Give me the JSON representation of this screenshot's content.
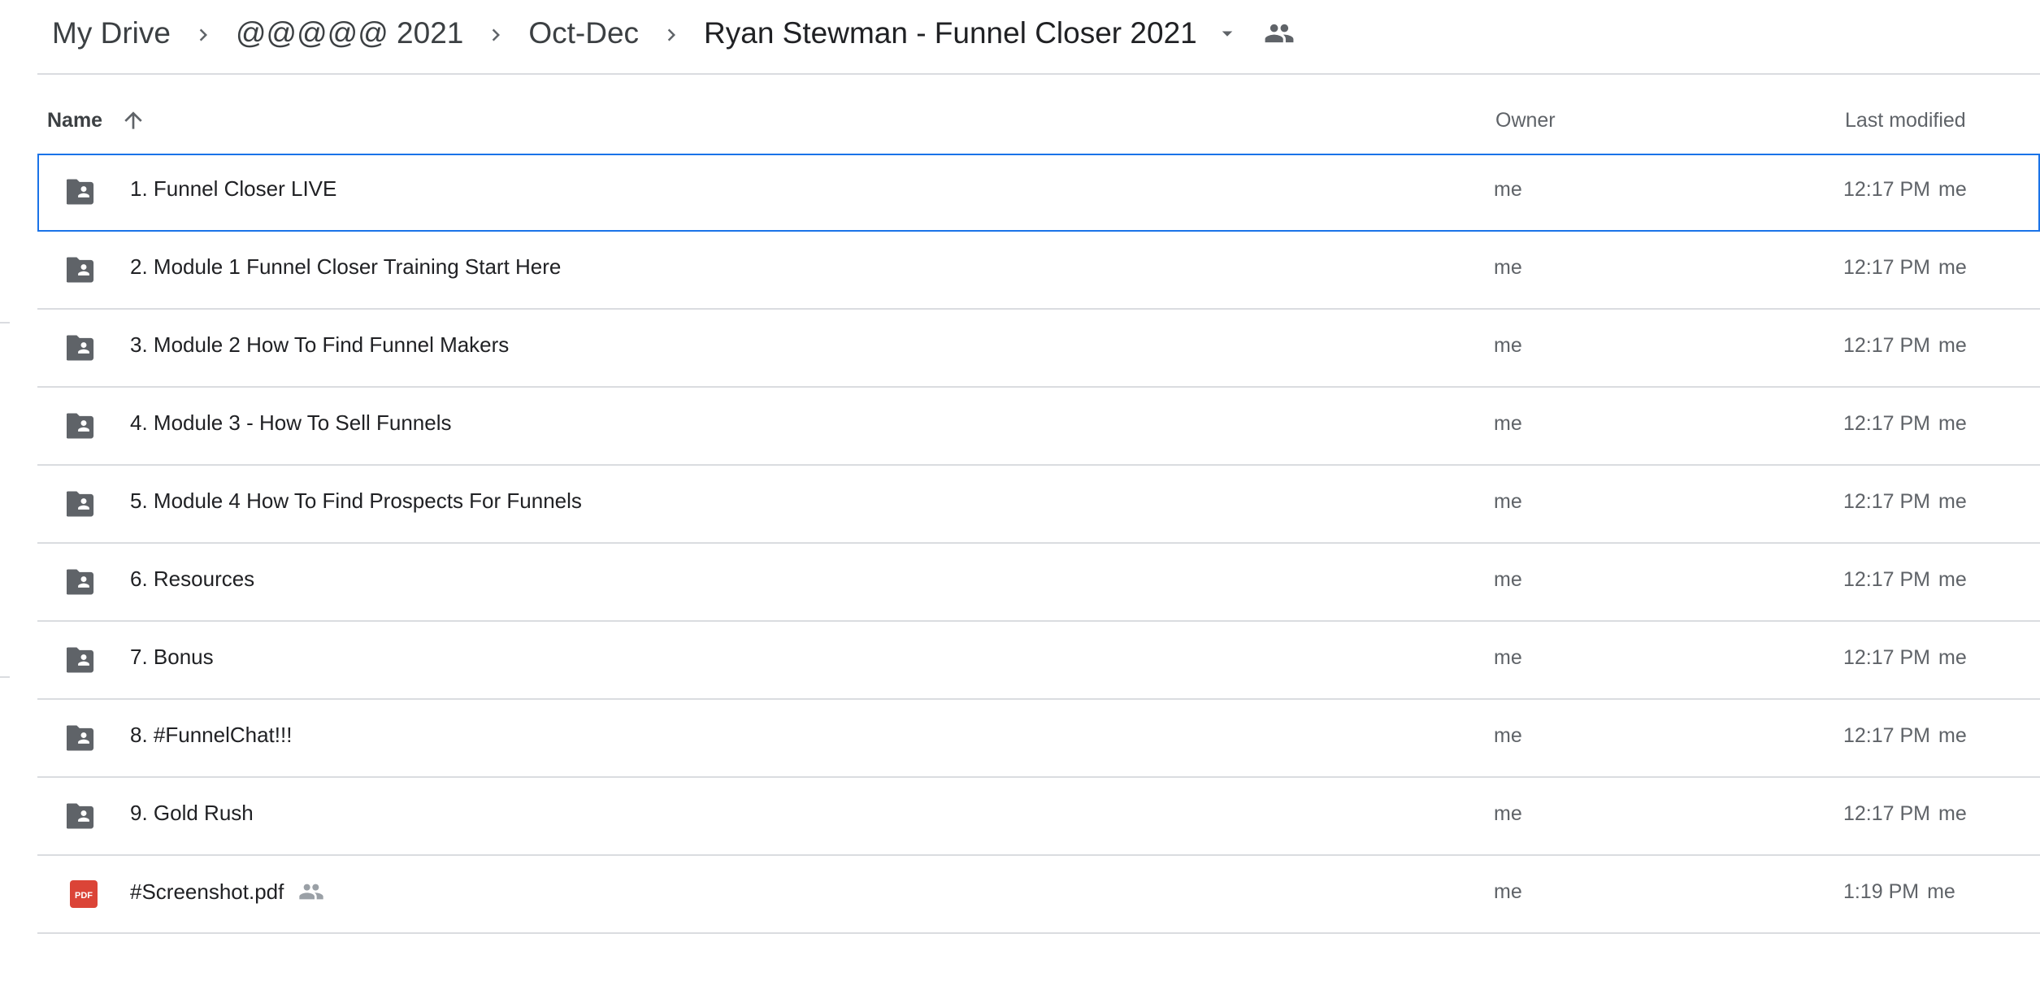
{
  "breadcrumb": {
    "items": [
      "My Drive",
      "@@@@@ 2021",
      "Oct-Dec",
      "Ryan Stewman - Funnel Closer 2021"
    ]
  },
  "columns": {
    "name": "Name",
    "owner": "Owner",
    "last_modified": "Last modified"
  },
  "files": [
    {
      "name": "1. Funnel Closer LIVE",
      "type": "shared-folder",
      "owner": "me",
      "modified": "12:17 PM",
      "modified_by": "me",
      "selected": true
    },
    {
      "name": "2. Module 1 Funnel Closer Training Start Here",
      "type": "shared-folder",
      "owner": "me",
      "modified": "12:17 PM",
      "modified_by": "me"
    },
    {
      "name": "3. Module 2 How To Find Funnel Makers",
      "type": "shared-folder",
      "owner": "me",
      "modified": "12:17 PM",
      "modified_by": "me"
    },
    {
      "name": "4. Module 3 - How To Sell Funnels",
      "type": "shared-folder",
      "owner": "me",
      "modified": "12:17 PM",
      "modified_by": "me"
    },
    {
      "name": "5. Module 4 How To Find Prospects For Funnels",
      "type": "shared-folder",
      "owner": "me",
      "modified": "12:17 PM",
      "modified_by": "me"
    },
    {
      "name": "6. Resources",
      "type": "shared-folder",
      "owner": "me",
      "modified": "12:17 PM",
      "modified_by": "me"
    },
    {
      "name": "7. Bonus",
      "type": "shared-folder",
      "owner": "me",
      "modified": "12:17 PM",
      "modified_by": "me"
    },
    {
      "name": "8. #FunnelChat!!!",
      "type": "shared-folder",
      "owner": "me",
      "modified": "12:17 PM",
      "modified_by": "me"
    },
    {
      "name": "9. Gold Rush",
      "type": "shared-folder",
      "owner": "me",
      "modified": "12:17 PM",
      "modified_by": "me"
    },
    {
      "name": "#Screenshot.pdf",
      "type": "pdf",
      "pdf_badge": "PDF",
      "shared": true,
      "owner": "me",
      "modified": "1:19 PM",
      "modified_by": "me"
    }
  ],
  "icons": {
    "separator": "chevron-right-icon",
    "dropdown": "arrow-drop-down-icon",
    "shared": "people-icon",
    "sort": "arrow-upward-icon",
    "folder": "shared-folder-icon",
    "pdf": "pdf-file-icon"
  },
  "colors": {
    "selection": "#1a73e8",
    "folder": "#5f6368",
    "pdf": "#db4437",
    "divider": "#dadce0"
  }
}
